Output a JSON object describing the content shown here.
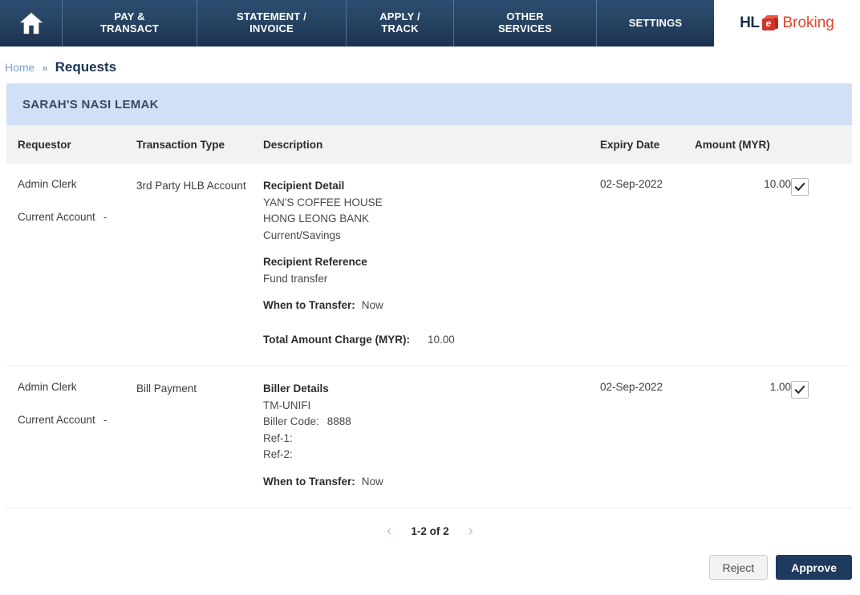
{
  "topnav": {
    "home_icon": "home-icon",
    "items": [
      {
        "label": "PAY &\nTRANSACT",
        "name": "pay-transact"
      },
      {
        "label": "STATEMENT /\nINVOICE",
        "name": "statement-invoice"
      },
      {
        "label": "APPLY /\nTRACK",
        "name": "apply-track"
      },
      {
        "label": "OTHER\nSERVICES",
        "name": "other-services"
      },
      {
        "label": "SETTINGS",
        "name": "settings"
      }
    ],
    "logo": {
      "hl": "HL",
      "cube_letter": "e",
      "broking": "Broking"
    }
  },
  "breadcrumb": {
    "home": "Home",
    "separator": "»",
    "current": "Requests"
  },
  "panel": {
    "title": "SARAH'S NASI LEMAK",
    "columns": {
      "requestor": "Requestor",
      "transaction_type": "Transaction Type",
      "description": "Description",
      "expiry_date": "Expiry Date",
      "amount": "Amount (MYR)"
    },
    "rows": [
      {
        "requestor": "Admin Clerk",
        "account": "Current Account",
        "account_value": "-",
        "transaction_type": "3rd Party HLB Account",
        "desc_head_1": "Recipient Detail",
        "desc_line_1": "YAN'S COFFEE HOUSE",
        "desc_line_2": "HONG LEONG BANK",
        "desc_line_3": "Current/Savings",
        "desc_head_2": "Recipient Reference",
        "desc_line_4": "Fund transfer",
        "when_label": "When to Transfer:",
        "when_value": "Now",
        "total_label": "Total Amount Charge (MYR):",
        "total_value": "10.00",
        "expiry_date": "02-Sep-2022",
        "amount": "10.00",
        "checked": true
      },
      {
        "requestor": "Admin Clerk",
        "account": "Current Account",
        "account_value": "-",
        "transaction_type": "Bill Payment",
        "desc_head_1": "Biller Details",
        "desc_line_1": "TM-UNIFI",
        "biller_code_label": "Biller Code:",
        "biller_code_value": "8888",
        "ref1_label": "Ref-1:",
        "ref2_label": "Ref-2:",
        "when_label": "When to Transfer:",
        "when_value": "Now",
        "expiry_date": "02-Sep-2022",
        "amount": "1.00",
        "checked": true
      }
    ]
  },
  "footer": {
    "prev_icon": "chevron-left-icon",
    "next_icon": "chevron-right-icon",
    "page_label": "1-2 of 2",
    "reject_label": "Reject",
    "approve_label": "Approve"
  },
  "colors": {
    "nav_navy": "#274463",
    "panel_blue": "#d2e0f7",
    "header_gray": "#f2f2f2",
    "approve_navy": "#1f3a5f",
    "logo_red": "#e8432b",
    "link_blue": "#7aa2cc"
  }
}
